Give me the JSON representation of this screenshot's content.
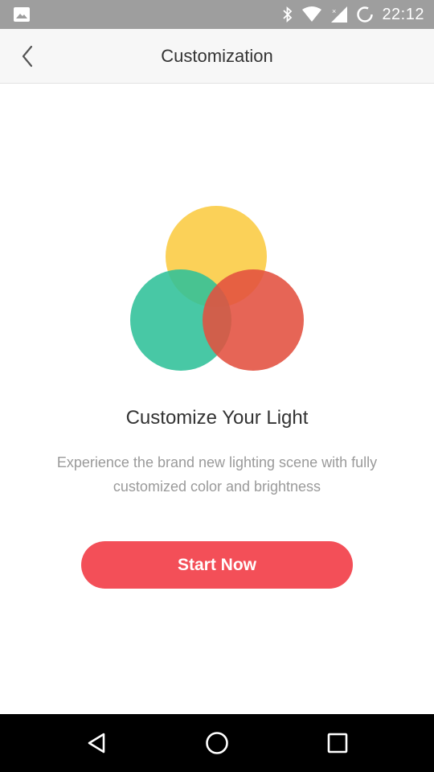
{
  "status_bar": {
    "time": "22:12",
    "icons": [
      "image-icon",
      "bluetooth-icon",
      "wifi-icon",
      "signal-icon",
      "sync-icon"
    ]
  },
  "app_bar": {
    "title": "Customization",
    "back_icon": "chevron-left-icon"
  },
  "illustration": {
    "circles": [
      {
        "name": "yellow",
        "color": "#fbcf4f"
      },
      {
        "name": "green",
        "color": "#2fc098"
      },
      {
        "name": "red",
        "color": "#e2503f"
      }
    ]
  },
  "main": {
    "headline": "Customize Your Light",
    "description": "Experience the brand new lighting scene with fully customized color and brightness",
    "start_button_label": "Start Now"
  },
  "nav_bar": {
    "icons": [
      "back-triangle-icon",
      "home-circle-icon",
      "recents-square-icon"
    ]
  },
  "colors": {
    "accent": "#f34f58",
    "status_bar": "#9e9e9e",
    "app_bar": "#f7f7f7",
    "nav_bar": "#000000"
  }
}
